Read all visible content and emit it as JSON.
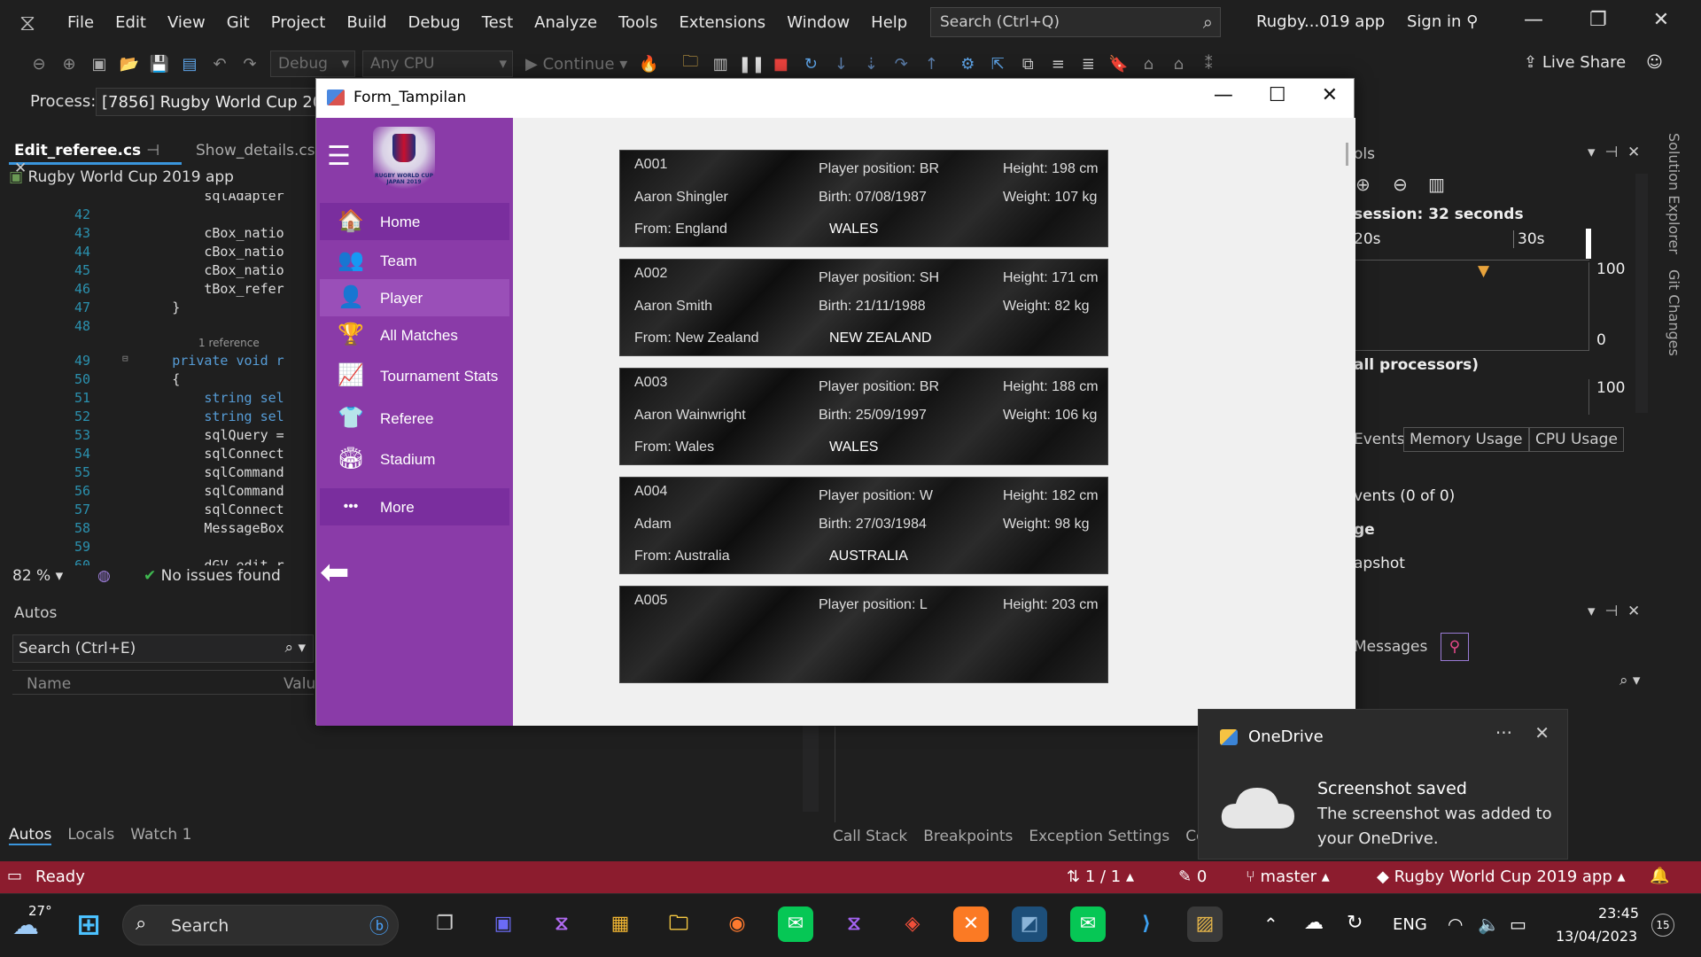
{
  "menu": [
    "File",
    "Edit",
    "View",
    "Git",
    "Project",
    "Build",
    "Debug",
    "Test",
    "Analyze",
    "Tools",
    "Extensions",
    "Window",
    "Help"
  ],
  "search": {
    "placeholder": "Search (Ctrl+Q)"
  },
  "vs_title": "Rugby...019 app",
  "sign_in": "Sign in",
  "toolbar": {
    "config": "Debug",
    "platform": "Any CPU",
    "continue": "Continue",
    "live_share": "Live Share"
  },
  "process": {
    "label": "Process:",
    "value": "[7856] Rugby World Cup 2019"
  },
  "editor": {
    "tabs": [
      "Edit_referee.cs",
      "Show_details.cs"
    ],
    "nav": "Rugby World Cup 2019 app",
    "lines": [
      {
        "n": "",
        "t": "            sqlAdapter"
      },
      {
        "n": "42",
        "t": ""
      },
      {
        "n": "43",
        "t": "            cBox_natio"
      },
      {
        "n": "44",
        "t": "            cBox_natio"
      },
      {
        "n": "45",
        "t": "            cBox_natio"
      },
      {
        "n": "46",
        "t": "            tBox_refer"
      },
      {
        "n": "47",
        "t": "        }"
      },
      {
        "n": "48",
        "t": ""
      },
      {
        "n": "49",
        "t": "        private void r"
      },
      {
        "n": "50",
        "t": "        {"
      },
      {
        "n": "51",
        "t": "            string sel"
      },
      {
        "n": "52",
        "t": "            string sel"
      },
      {
        "n": "53",
        "t": "            sqlQuery ="
      },
      {
        "n": "54",
        "t": "            sqlConnect"
      },
      {
        "n": "55",
        "t": "            sqlCommand"
      },
      {
        "n": "56",
        "t": "            sqlCommand"
      },
      {
        "n": "57",
        "t": "            sqlConnect"
      },
      {
        "n": "58",
        "t": "            MessageBox"
      },
      {
        "n": "59",
        "t": ""
      },
      {
        "n": "60",
        "t": "            dGV_edit_r"
      }
    ],
    "reference": "1 reference",
    "zoom": "82 %",
    "issues": "No issues found"
  },
  "autos": {
    "title": "Autos",
    "search": "Search (Ctrl+E)",
    "col_name": "Name",
    "col_value": "Valu"
  },
  "bottom_tabs": [
    "Autos",
    "Locals",
    "Watch 1"
  ],
  "debug_tabs": [
    "Call Stack",
    "Breakpoints",
    "Exception Settings",
    "Com"
  ],
  "diag": {
    "title": "ols",
    "session": "session: 32 seconds",
    "t20": "20s",
    "t30": "30s",
    "v100": "100",
    "v0": "0",
    "cpu": "all processors)",
    "v100b": "100",
    "tabs": [
      "Events",
      "Memory Usage",
      "CPU Usage"
    ],
    "events": "vents (0 of 0)",
    "row2": "ge",
    "row3": "apshot",
    "messages": "Messages"
  },
  "side": [
    "Solution Explorer",
    "Git Changes"
  ],
  "status": {
    "ready": "Ready",
    "lines": "1 / 1",
    "pencil": "0",
    "branch": "master",
    "repo": "Rugby World Cup 2019 app"
  },
  "form": {
    "title": "Form_Tampilan",
    "logo_text": "RUGBY WORLD CUP JAPAN 2019",
    "nav": [
      {
        "label": "Home",
        "icon": "home-icon",
        "glyph": "🏠"
      },
      {
        "label": "Team",
        "icon": "team-icon",
        "glyph": "👥"
      },
      {
        "label": "Player",
        "icon": "player-icon",
        "glyph": "👤"
      },
      {
        "label": "All Matches",
        "icon": "trophy-icon",
        "glyph": "🏆"
      },
      {
        "label": "Tournament Stats",
        "icon": "stats-icon",
        "glyph": "📈"
      },
      {
        "label": "Referee",
        "icon": "shirt-icon",
        "glyph": "👕"
      },
      {
        "label": "Stadium",
        "icon": "stadium-icon",
        "glyph": "🏟"
      },
      {
        "label": "More",
        "icon": "more-icon",
        "glyph": "•••"
      }
    ],
    "players": [
      {
        "id": "A001",
        "name": "Aaron Shingler",
        "from": "From: England",
        "pos": "Player position: BR",
        "birth": "Birth: 07/08/1987",
        "nat": "WALES",
        "h": "Height: 198 cm",
        "w": "Weight: 107 kg"
      },
      {
        "id": "A002",
        "name": "Aaron Smith",
        "from": "From: New Zealand",
        "pos": "Player position: SH",
        "birth": "Birth: 21/11/1988",
        "nat": "NEW ZEALAND",
        "h": "Height: 171 cm",
        "w": "Weight: 82 kg"
      },
      {
        "id": "A003",
        "name": "Aaron Wainwright",
        "from": "From:  Wales",
        "pos": "Player position: BR",
        "birth": "Birth: 25/09/1997",
        "nat": "WALES",
        "h": "Height: 188 cm",
        "w": "Weight: 106 kg"
      },
      {
        "id": "A004",
        "name": "Adam",
        "from": "From: Australia",
        "pos": "Player position: W",
        "birth": "Birth: 27/03/1984",
        "nat": "AUSTRALIA",
        "h": "Height: 182 cm",
        "w": "Weight: 98 kg"
      },
      {
        "id": "A005",
        "name": "",
        "from": "",
        "pos": "Player position: L",
        "birth": "",
        "nat": "",
        "h": "Height: 203 cm",
        "w": ""
      }
    ]
  },
  "toast": {
    "app": "OneDrive",
    "title": "Screenshot saved",
    "body": "The screenshot was added to your OneDrive."
  },
  "taskbar": {
    "temp": "27°",
    "search": "Search",
    "lang": "ENG",
    "time": "23:45",
    "date": "13/04/2023",
    "badge": "15"
  },
  "colors": {
    "accent": "#8a3ba8",
    "status": "#8c1c2e",
    "vs_bg": "#1f1f1f"
  }
}
